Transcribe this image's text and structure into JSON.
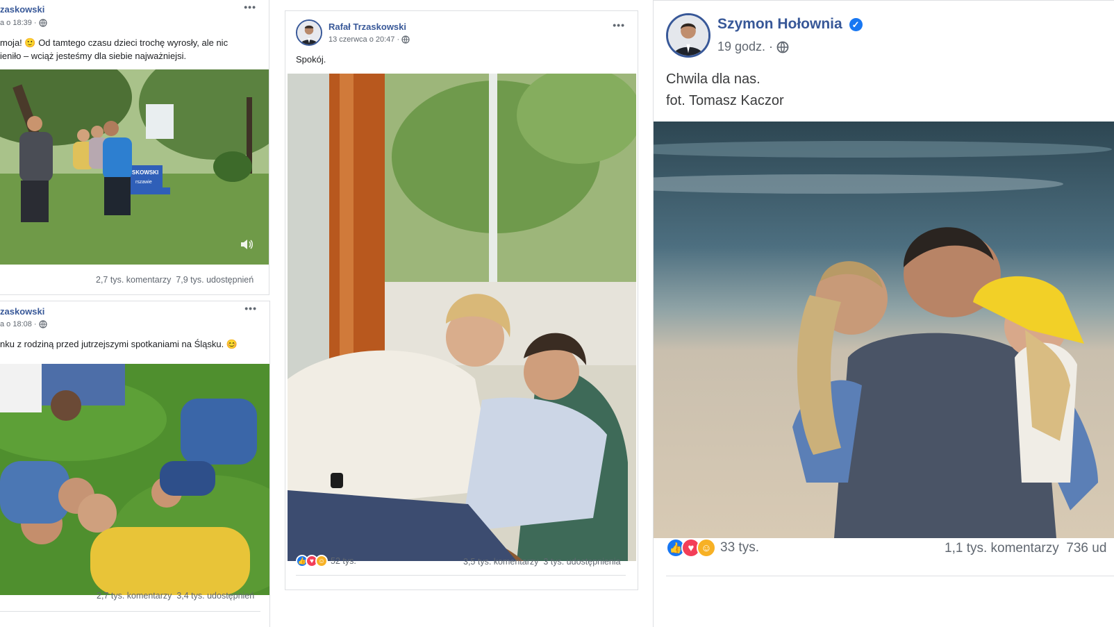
{
  "posts": [
    {
      "author": "zaskowski",
      "time": "a o 18:39 ·",
      "text": "moja! 🙂 Od tamtego czasu dzieci trochę wyrosły, ale nic\nieniło – wciąż jesteśmy dla siebie najważniejsi.",
      "comments": "2,7 tys. komentarzy",
      "shares": "7,9 tys. udostępnień",
      "photo_icon": "park-bench-family-photo",
      "bench_text": "SKOWSKI\nrszawie"
    },
    {
      "author": "zaskowski",
      "time": "a o 18:08 ·",
      "text": "nku z rodziną przed jutrzejszymi spotkaniami na Śląsku. 😊",
      "comments": "2,7 tys. komentarzy",
      "shares": "3,4 tys. udostępnień",
      "photo_icon": "family-on-grass-photo"
    },
    {
      "author": "Rafał Trzaskowski",
      "time": "13 czerwca o 20:47 ·",
      "text": "Spokój.",
      "reactions_count": "52 tys.",
      "comments": "3,5 tys. komentarzy",
      "shares": "3 tys. udostępnienia",
      "photo_icon": "couple-armchair-photo"
    },
    {
      "author": "Szymon Hołownia",
      "time": "19 godz. ·",
      "text": "Chwila dla nas.\nfot. Tomasz Kaczor",
      "reactions_count": "33 tys.",
      "comments": "1,1 tys. komentarzy",
      "shares": "736 ud",
      "photo_icon": "father-hugging-children-beach-photo"
    }
  ],
  "colors": {
    "author_blue": "#385898",
    "meta_gray": "#606770",
    "like_blue": "#1877f2",
    "love_red": "#f33e58",
    "care_yellow": "#f7b125",
    "divider": "#dddfe2"
  },
  "icons": {
    "more": "more-options-icon",
    "privacy": "globe-icon",
    "sound": "speaker-icon",
    "verified": "verified-badge-icon"
  }
}
